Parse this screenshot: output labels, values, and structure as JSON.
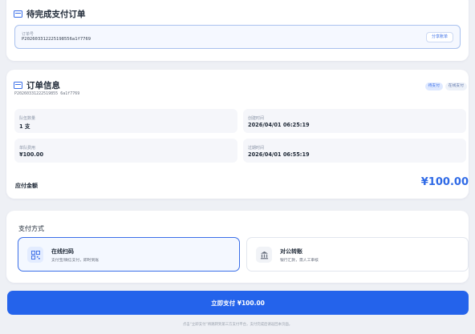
{
  "pending": {
    "title": "待完成支付订单",
    "order_label": "订单号",
    "order_no": "P202603312225198556a1f7769",
    "view_button": "分享账单"
  },
  "info": {
    "title": "订单信息",
    "order_no": "P20260331222519855 6a1f7769",
    "badges": [
      "待支付",
      "在线支付"
    ],
    "fields": [
      {
        "label": "队伍数量",
        "value": "1 支"
      },
      {
        "label": "创建时间",
        "value": "2026/04/01 06:25:19"
      },
      {
        "label": "单队费用",
        "value": "¥100.00"
      },
      {
        "label": "过期时间",
        "value": "2026/04/01 06:55:19"
      }
    ],
    "total_label": "应付金额",
    "total_amount": "¥100.00"
  },
  "payment": {
    "title": "支付方式",
    "options": [
      {
        "name": "在线扫码",
        "desc": "支付宝/微信支付，即时到账",
        "icon": "qr-code-icon",
        "selected": true
      },
      {
        "name": "对公转账",
        "desc": "银行汇款，需人工审核",
        "icon": "bank-icon",
        "selected": false
      }
    ]
  },
  "pay_button": "立即支付 ¥100.00",
  "footnote": "点击“立即支付”将跳转到第三方支付平台，支付完成后请返回本页面。",
  "colors": {
    "accent": "#2463eb",
    "background": "#eef0f5"
  }
}
